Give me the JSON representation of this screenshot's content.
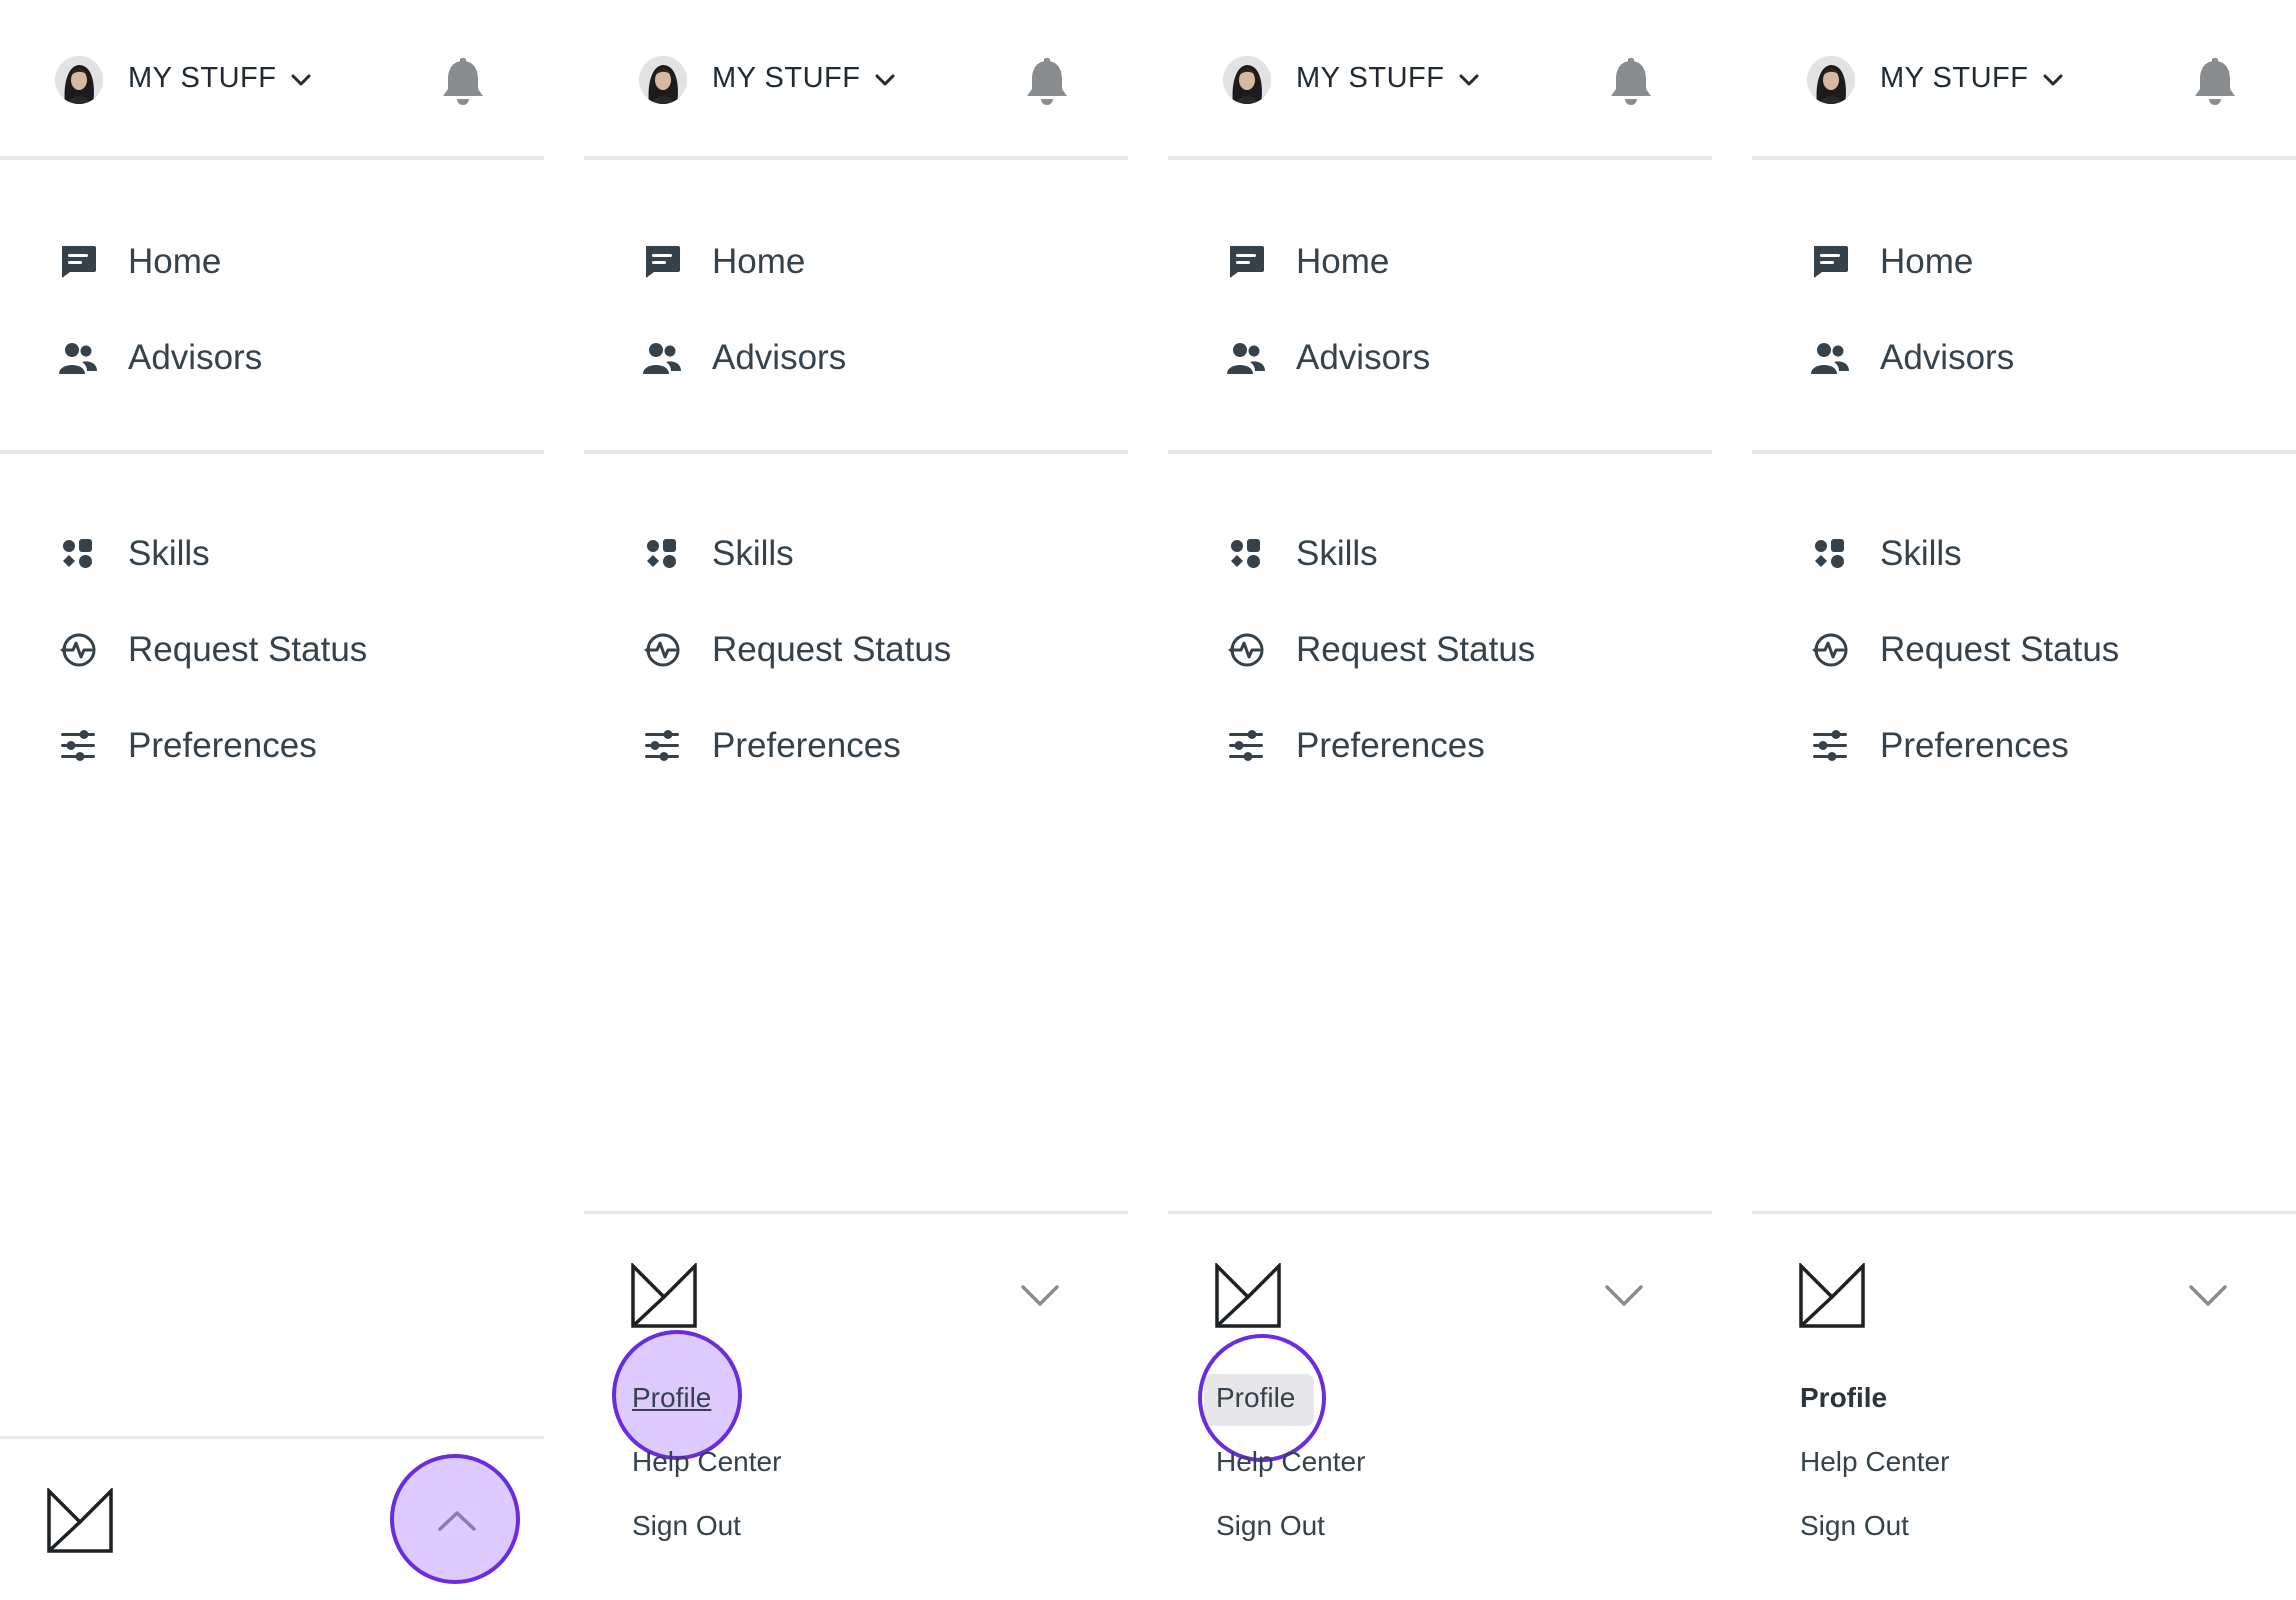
{
  "header": {
    "menu_label": "MY STUFF"
  },
  "primary_nav": [
    {
      "label": "Home",
      "icon": "message-icon"
    },
    {
      "label": "Advisors",
      "icon": "people-icon"
    }
  ],
  "secondary_nav": [
    {
      "label": "Skills",
      "icon": "apps-icon"
    },
    {
      "label": "Request Status",
      "icon": "activity-icon"
    },
    {
      "label": "Preferences",
      "icon": "sliders-icon"
    }
  ],
  "footer_menu": [
    {
      "label": "Profile"
    },
    {
      "label": "Help Center"
    },
    {
      "label": "Sign Out"
    }
  ],
  "colors": {
    "text": "#36424b",
    "icon": "#36424b",
    "bell": "#8a8d90",
    "divider": "#e6e8ea",
    "highlight_border": "#6a2ce0",
    "highlight_fill": "#c1a1ff",
    "pill": "#e7e7e9"
  }
}
